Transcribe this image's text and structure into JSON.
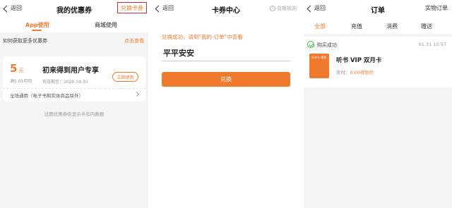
{
  "coupons_screen": {
    "back_label": "返回",
    "title": "我的优惠券",
    "redeem_label": "兑换卡券",
    "tabs": [
      "App使用",
      "商城使用"
    ],
    "more_text": "如何获取更多优惠券",
    "more_link": "点击查看",
    "coupon": {
      "amount": "5",
      "unit": "元",
      "condition": "满5.01可用",
      "name": "初来得到用户专享",
      "validity": "有效期至：2020.04.30",
      "use_button": "立即使用",
      "scope": "全场通用（电子书和实体商品除外）"
    },
    "footnote": "过期优惠券仅显示半年内数据"
  },
  "card_center_screen": {
    "back_label": "返回",
    "title": "卡券中心",
    "rules_label": "兑换规则",
    "success_hint": "兑换成功，请到\"我的-订单\"中查看",
    "code_value": "平平安安",
    "redeem_button": "兑换"
  },
  "orders_screen": {
    "back_label": "返回",
    "title": "订单",
    "right_label": "实物订单",
    "tabs": [
      "全部",
      "充值",
      "消费",
      "赠送"
    ],
    "order": {
      "status": "购买成功",
      "time": "01.31  15:57",
      "thumb_text": "听书卡 得到",
      "name": "听书 VIP 双月卡",
      "paid_label": "实付：",
      "paid_value": "0.00得到贝"
    }
  },
  "colors": {
    "accent": "#ef7a2e",
    "highlight_box": "#d32a2a",
    "success": "#3ab54a"
  }
}
